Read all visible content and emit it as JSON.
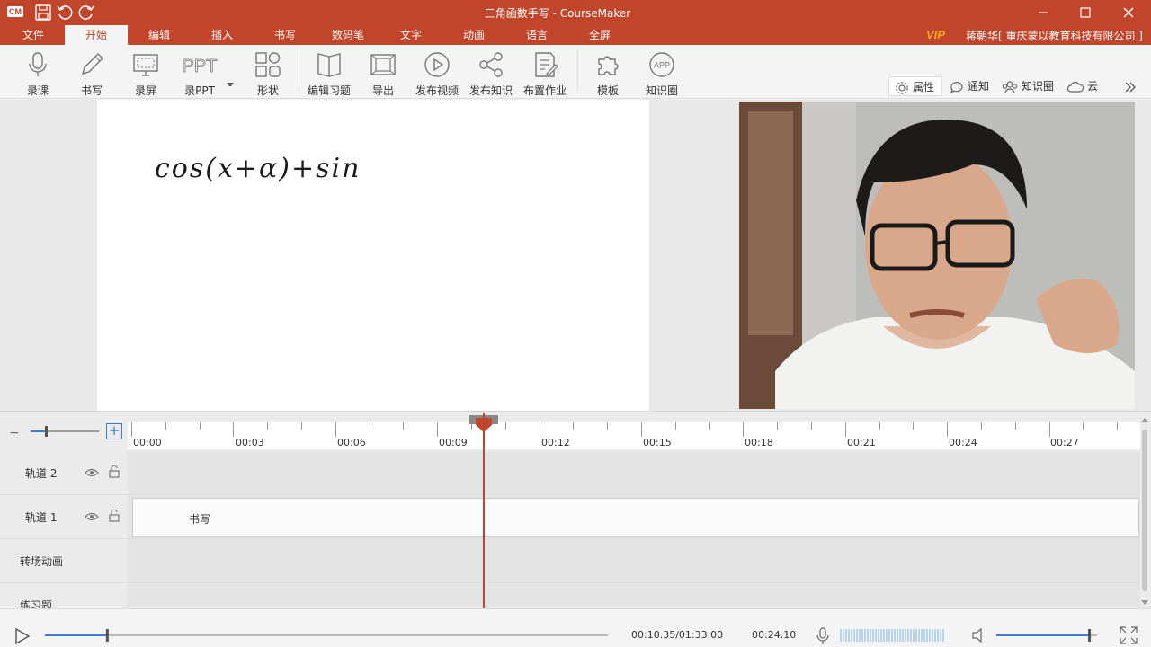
{
  "window": {
    "logo": "CM",
    "title": "三角函数手写 - CourseMaker"
  },
  "menu": {
    "items": [
      {
        "label": "文件"
      },
      {
        "label": "开始"
      },
      {
        "label": "编辑"
      },
      {
        "label": "插入"
      },
      {
        "label": "书写"
      },
      {
        "label": "数码笔"
      },
      {
        "label": "文字"
      },
      {
        "label": "动画"
      },
      {
        "label": "语言"
      },
      {
        "label": "全屏"
      }
    ],
    "active_index": 1,
    "vip": "VIP",
    "user": "蒋朝华[ 重庆蒙以教育科技有限公司 ]"
  },
  "ribbon": {
    "buttons": [
      {
        "label": "录课",
        "icon": "microphone-icon"
      },
      {
        "label": "书写",
        "icon": "pen-icon"
      },
      {
        "label": "录屏",
        "icon": "screen-record-icon"
      },
      {
        "label": "录PPT",
        "icon": "ppt-icon"
      },
      {
        "label": "形状",
        "icon": "shapes-icon"
      },
      {
        "label": "编辑习题",
        "icon": "book-icon"
      },
      {
        "label": "导出",
        "icon": "export-icon"
      },
      {
        "label": "发布视频",
        "icon": "play-circle-icon"
      },
      {
        "label": "发布知识",
        "icon": "share-icon"
      },
      {
        "label": "布置作业",
        "icon": "assignment-icon"
      },
      {
        "label": "模板",
        "icon": "puzzle-icon"
      },
      {
        "label": "知识圈",
        "icon": "app-icon"
      }
    ],
    "ppt_text": "PPT",
    "app_text": "APP",
    "side": {
      "properties": "属性",
      "notify": "通知",
      "circle": "知识圈",
      "cloud": "云"
    }
  },
  "board": {
    "handwriting": "cos(x+α)+sin"
  },
  "timeline": {
    "ticks": [
      "00:00",
      "00:03",
      "00:06",
      "00:09",
      "00:12",
      "00:15",
      "00:18",
      "00:21",
      "00:24",
      "00:27"
    ],
    "tracks": [
      {
        "name": "轨道 2"
      },
      {
        "name": "轨道 1"
      },
      {
        "name": "转场动画"
      },
      {
        "name": "练习题"
      }
    ],
    "clip_label": "书写",
    "playhead_time": "00:10.35",
    "zoom_minus": "−",
    "zoom_plus": "+"
  },
  "playback": {
    "position": "00:10.35/01:33.00",
    "duration": "00:24.10",
    "progress_fraction": 0.11,
    "volume_fraction": 0.92
  },
  "colors": {
    "brand": "#c0452b",
    "accent_blue": "#3a7bd5",
    "vip": "#f5a623"
  }
}
